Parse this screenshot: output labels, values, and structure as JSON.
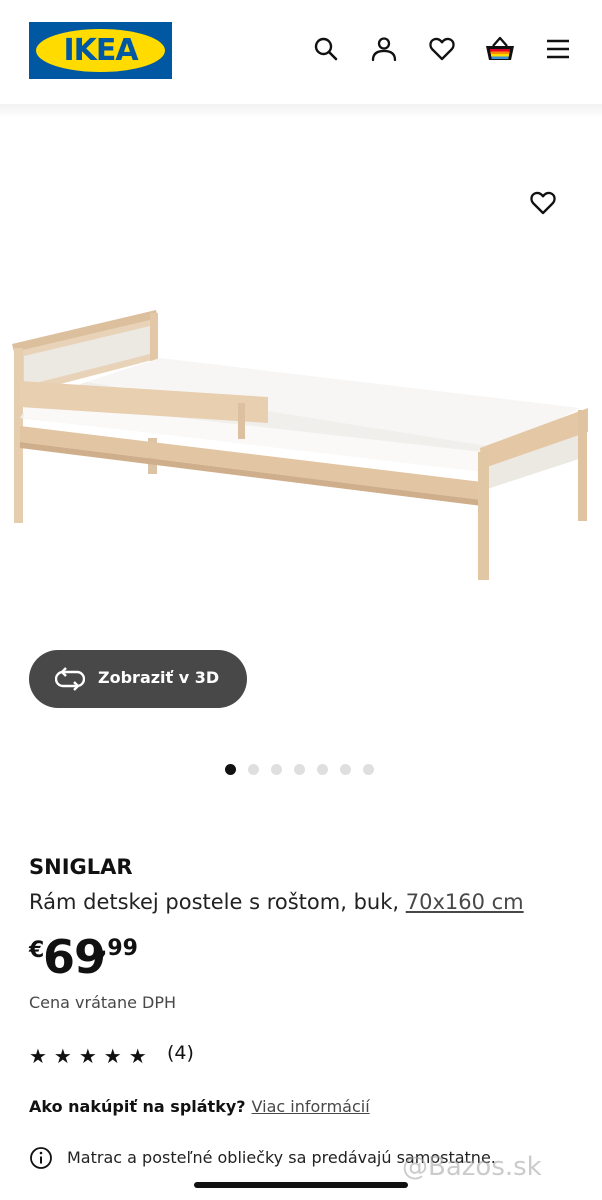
{
  "header": {
    "logo_text": "IKEA",
    "icons": [
      "search-icon",
      "account-icon",
      "heart-icon",
      "cart-icon",
      "menu-icon"
    ]
  },
  "gallery": {
    "view_3d_label": "Zobraziť v 3D",
    "dot_count": 7,
    "active_dot": 1
  },
  "product": {
    "name": "SNIGLAR",
    "description": "Rám detskej postele s roštom, buk, ",
    "size": "70x160 cm",
    "price_currency": "€",
    "price_integer": "69",
    "price_decimal": ",99",
    "vat_note": "Cena vrátane DPH",
    "rating_stars": "★★★★★",
    "rating_count": "(4)"
  },
  "installment": {
    "question": "Ako nakúpiť na splátky?",
    "link": "Viac informácií"
  },
  "notice": {
    "text": "Matrac a posteľné obliečky sa predávajú samostatne."
  },
  "watermark": "@Bazos.sk",
  "colors": {
    "ikea_blue": "#0058a3",
    "ikea_yellow": "#ffdb00",
    "button_dark": "#484848"
  }
}
